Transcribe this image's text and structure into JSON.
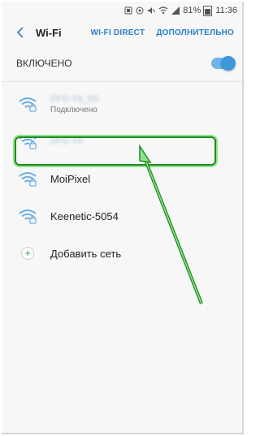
{
  "status_bar": {
    "battery": "81%",
    "time": "11:36"
  },
  "header": {
    "title": "Wi-Fi",
    "wifi_direct": "WI-FI DIRECT",
    "advanced": "ДОПОЛНИТЕЛЬНО"
  },
  "toggle": {
    "label": "ВКЛЮЧЕНО",
    "state": "on"
  },
  "networks": [
    {
      "name": "DFD-Y6_5G",
      "status": "Подключено",
      "secured": true,
      "blurred": true
    },
    {
      "name": "DFD-Y6",
      "status": "",
      "secured": true,
      "blurred": true
    },
    {
      "name": "MoiPixel",
      "status": "",
      "secured": true,
      "blurred": false,
      "highlighted": true
    },
    {
      "name": "Keenetic-5054",
      "status": "",
      "secured": true,
      "blurred": false
    }
  ],
  "add_network": {
    "label": "Добавить сеть"
  },
  "colors": {
    "accent": "#2c7fc8",
    "toggle": "#3d98dc",
    "wifi_icon": "#6aaee0",
    "highlight": "#1e8c1e",
    "add_plus": "#29a84a"
  }
}
